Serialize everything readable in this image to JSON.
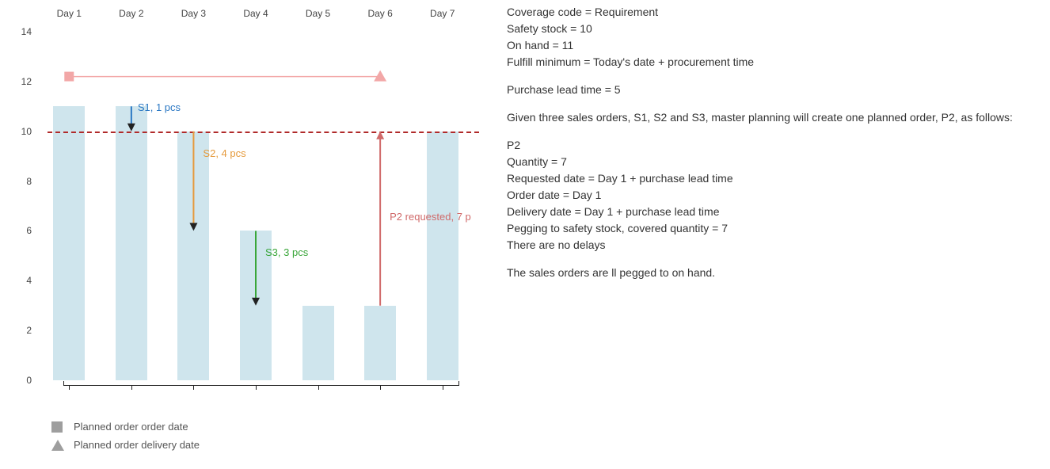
{
  "chart_data": {
    "type": "bar",
    "categories": [
      "Day 1",
      "Day 2",
      "Day 3",
      "Day 4",
      "Day 5",
      "Day 6",
      "Day 7"
    ],
    "values": [
      11,
      11,
      10,
      6,
      3,
      3,
      10
    ],
    "ylim": [
      0,
      14
    ],
    "y_ticks": [
      0,
      2,
      4,
      6,
      8,
      10,
      12,
      14
    ],
    "safety_stock_line": 10,
    "planned_order": {
      "order_date_day": 1,
      "delivery_date_day": 6,
      "order_y": 12.2,
      "color": "#f2a7a7"
    },
    "arrows": [
      {
        "id": "S1",
        "label": "S1, 1 pcs",
        "day": 2,
        "from_y": 11,
        "to_y": 10,
        "color": "#2b78c4"
      },
      {
        "id": "S2",
        "label": "S2, 4 pcs",
        "day": 3,
        "from_y": 10,
        "to_y": 6,
        "color": "#e59a3c"
      },
      {
        "id": "S3",
        "label": "S3, 3 pcs",
        "day": 4,
        "from_y": 6,
        "to_y": 3,
        "color": "#3aa63a"
      },
      {
        "id": "P2",
        "label": "P2 requested, 7 p",
        "day": 6,
        "from_y": 3,
        "to_y": 10,
        "color": "#d06a6a"
      }
    ]
  },
  "legend": {
    "order_date": "Planned order order date",
    "delivery_date": "Planned order delivery date"
  },
  "info": {
    "l1": "Coverage code = Requirement",
    "l2": "Safety stock = 10",
    "l3": "On hand = 11",
    "l4": "Fulfill minimum = Today's date + procurement time",
    "l5": "Purchase lead time = 5",
    "l6": "Given three sales orders, S1, S2 and S3, master planning will create one planned order, P2, as follows:",
    "l7": "P2",
    "l8": "Quantity = 7",
    "l9": "Requested date = Day 1 + purchase lead time",
    "l10": "Order date = Day 1",
    "l11": "Delivery date = Day 1 + purchase lead time",
    "l12": "Pegging to safety stock, covered quantity = 7",
    "l13": "There are no delays",
    "l14": " The sales orders are ll pegged to on hand."
  }
}
